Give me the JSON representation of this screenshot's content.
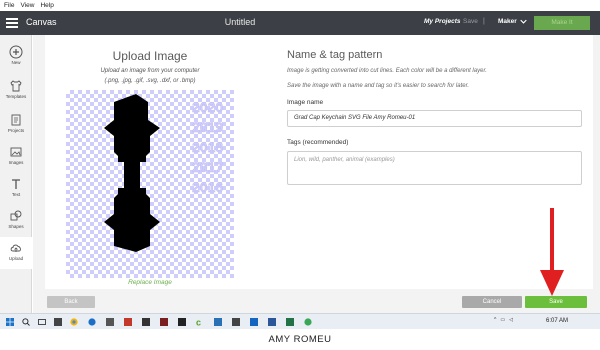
{
  "menubar": {
    "items": [
      "File",
      "View",
      "Help"
    ]
  },
  "header": {
    "app_title": "Canvas",
    "doc_title": "Untitled",
    "my_projects": "My Projects",
    "save": "Save",
    "divider": "|",
    "machine": "Maker",
    "make_it": "Make It"
  },
  "sidebar": {
    "items": [
      {
        "label": "New",
        "icon": "plus-icon"
      },
      {
        "label": "Templates",
        "icon": "shirt-icon"
      },
      {
        "label": "Projects",
        "icon": "projects-icon"
      },
      {
        "label": "Images",
        "icon": "image-icon"
      },
      {
        "label": "Text",
        "icon": "text-icon"
      },
      {
        "label": "Shapes",
        "icon": "shapes-icon"
      },
      {
        "label": "Upload",
        "icon": "upload-icon"
      }
    ],
    "active": "Upload"
  },
  "upload": {
    "title": "Upload Image",
    "subtitle": "Upload an image from your computer",
    "formats": "(.png, .jpg, .gif, .svg, .dxf, or .bmp)",
    "replace": "Replace Image",
    "ghost_years": [
      "2020",
      "2019",
      "2018",
      "2017",
      "2016"
    ]
  },
  "form": {
    "title": "Name & tag pattern",
    "desc1": "Image is getting converted into cut lines. Each color will be a different layer.",
    "desc2": "Save the image with a name and tag so it's easier to search for later.",
    "name_label": "Image name",
    "name_value": "Grad Cap Keychain SVG File Amy Romeu-01",
    "tags_label": "Tags (recommended)",
    "tags_placeholder": "Lion, wild, panther, animal (examples)"
  },
  "buttons": {
    "back": "Back",
    "cancel": "Cancel",
    "save": "Save"
  },
  "taskbar": {
    "time": "6:07 AM"
  },
  "watermark": "AMY ROMEU",
  "colors": {
    "header_bg": "#3c4046",
    "accent_green": "#6cbf3c",
    "arrow_red": "#e02020"
  }
}
